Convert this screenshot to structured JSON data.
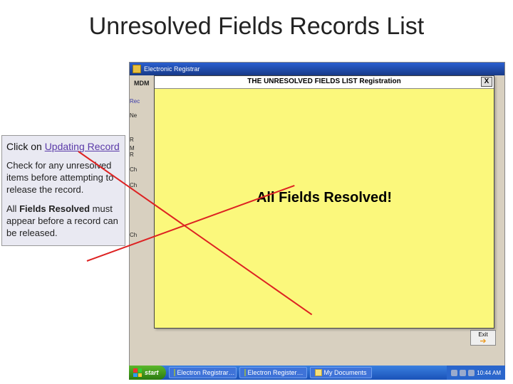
{
  "title": "Unresolved Fields Records List",
  "callout": {
    "sec1_prefix": "Click on ",
    "sec1_link": "Updating Record",
    "sec2": "Check for any unresolved items before attempting to release the record.",
    "sec3_prefix": "All ",
    "sec3_bold": "Fields Resolved",
    "sec3_suffix": " must appear before a record can be released."
  },
  "app": {
    "title": "Electronic Registrar",
    "mdm_label": "MDM",
    "exit_label": "Exit",
    "side": {
      "rec": "Rec",
      "ne": "Ne",
      "r": "R",
      "mr": "M\nR",
      "ch1": "Ch",
      "ch2": "Ch",
      "ch3": "Ch"
    }
  },
  "popup": {
    "title": "THE UNRESOLVED FIELDS LIST  Registration",
    "close": "X",
    "message": "All Fields Resolved!"
  },
  "taskbar": {
    "start": "start",
    "items": [
      "Electron Registrar…",
      "Electron Register…",
      "My Documents"
    ],
    "clock": "10:44 AM"
  }
}
